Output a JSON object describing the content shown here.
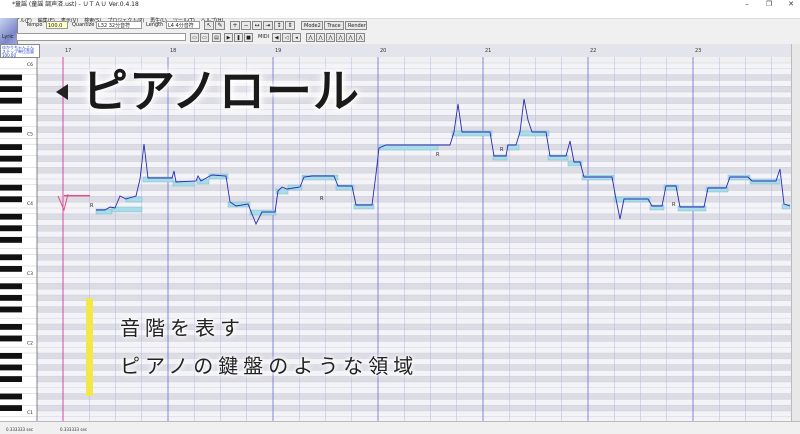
{
  "window": {
    "title": "*童謡 (童謡 調声済.ust) - ＵＴＡＵ Ver.0.4.18",
    "minimize": "–",
    "maximize": "❐",
    "close": "✕"
  },
  "menu": [
    "ファイル(F)",
    "編集(E)",
    "表示(V)",
    "検索(S)",
    "プロジェクト(P)",
    "再生(L)",
    "ツール(T)",
    "ヘルプ(H)"
  ],
  "toolbar": {
    "tempo_label": "Tempo",
    "tempo_value": "100.0",
    "quantize_label": "Quantize",
    "quantize_value": "L32 32分音符",
    "length_label": "Length",
    "length_value": "L4 4分音符",
    "mode2": "Mode2",
    "trace": "Trace",
    "render": "Render",
    "lyric_label": "Lyric",
    "midi_label": "MIDI"
  },
  "singer": {
    "line1": "ゆかりちゃんよん",
    "line2": "ステップ単位音量 100.00"
  },
  "roll": {
    "measures": [
      "17",
      "18",
      "19",
      "20",
      "21",
      "22",
      "23"
    ],
    "octaves": [
      "C6",
      "C5",
      "C4",
      "C3",
      "C2",
      "C1"
    ],
    "rest_marks": [
      "R",
      "R",
      "R",
      "R",
      "R"
    ]
  },
  "overlay": {
    "title": "ピアノロール",
    "line1": "音階を表す",
    "line2": "ピアノの鍵盤のような領域"
  },
  "status": {
    "left": "0.333333 sec",
    "right": "0.333333 sec"
  },
  "colors": {
    "note_fill": "#a8dde8",
    "pitch_curve": "#2a2ab0",
    "measure_line": "#7a7ad8",
    "beat_line": "#b0b8e8",
    "playhead": "#e040a0",
    "highlight": "#f2e84a"
  }
}
